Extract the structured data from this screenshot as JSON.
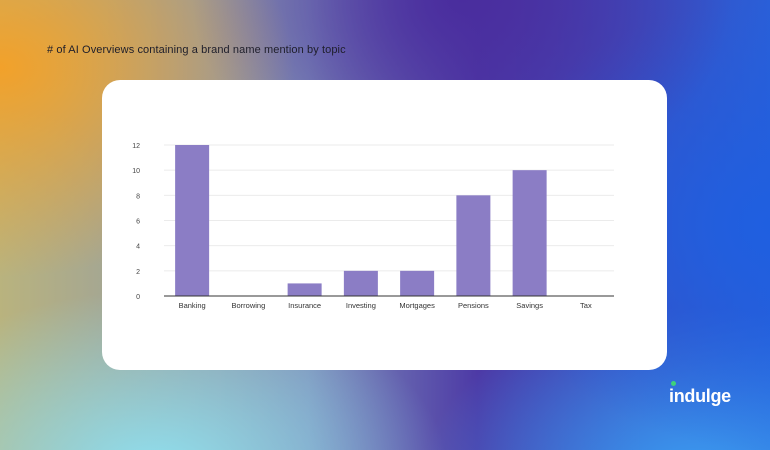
{
  "page": {
    "title": "# of AI Overviews containing a brand name mention by topic",
    "logo_text": "indulge"
  },
  "colors": {
    "bar": "#8b7dc5",
    "grid": "#ebebeb",
    "axis": "#333333",
    "logo_dot": "#3fd27a"
  },
  "chart_data": {
    "type": "bar",
    "categories": [
      "Banking",
      "Borrowing",
      "Insurance",
      "Investing",
      "Mortgages",
      "Pensions",
      "Savings",
      "Tax"
    ],
    "values": [
      12,
      0,
      1,
      2,
      2,
      8,
      10,
      0
    ],
    "ylim": [
      0,
      12
    ],
    "yticks": [
      0,
      2,
      4,
      6,
      8,
      10,
      12
    ],
    "grid": true,
    "legend": "none"
  }
}
